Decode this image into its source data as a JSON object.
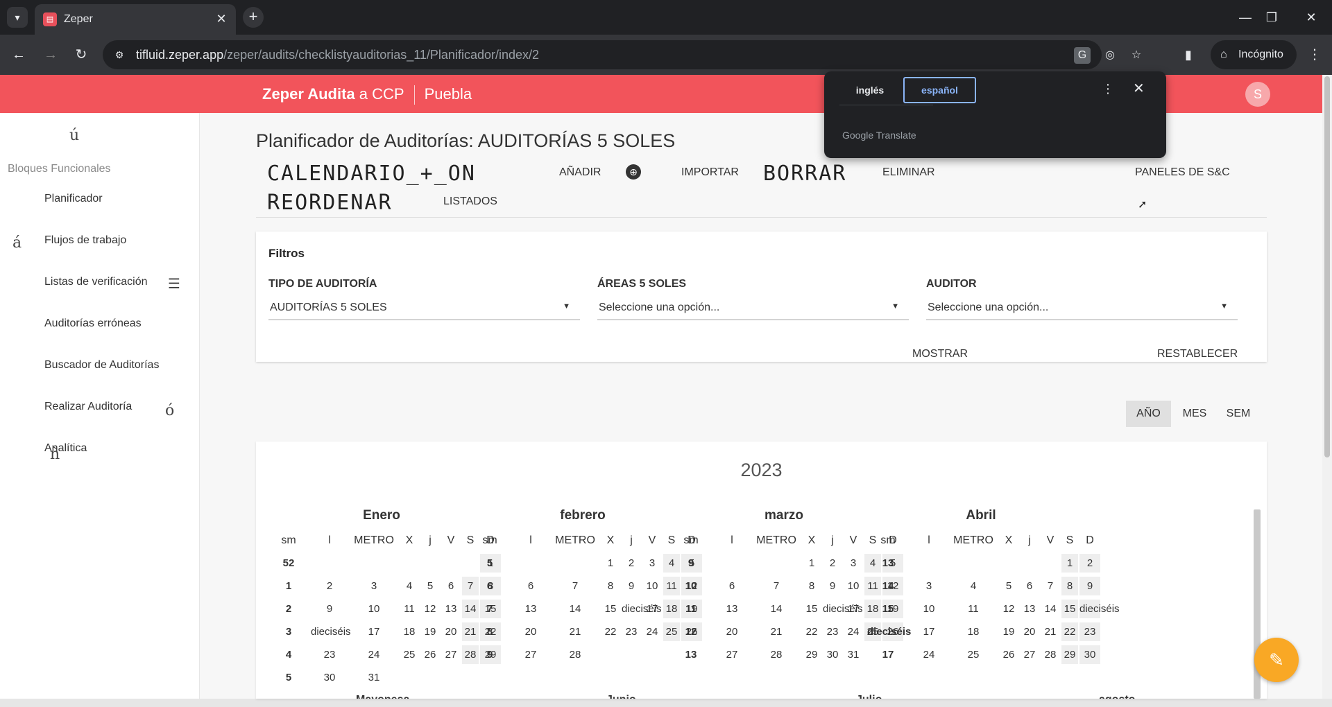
{
  "browser": {
    "tab_title": "Zeper",
    "url_host": "tifluid.zeper.app",
    "url_path": "/zeper/audits/checklistyauditorias_11/Planificador/index/2",
    "incognito_label": "Incógnito",
    "icons": [
      "chevron-down-icon",
      "favicon-icon",
      "close-icon",
      "plus-icon",
      "minimize-icon",
      "restore-icon",
      "close-window-icon",
      "back-icon",
      "forward-icon",
      "reload-icon",
      "site-info-icon",
      "translate-icon",
      "eye-off-icon",
      "star-icon",
      "side-panel-icon",
      "incognito-icon",
      "more-vert-icon"
    ]
  },
  "translate_popup": {
    "lang_source": "inglés",
    "lang_target": "español",
    "footer": "Google Translate"
  },
  "app": {
    "brand_strong": "Zeper Audita",
    "brand_rest": " a CCP",
    "location": "Puebla",
    "avatar_initial": "S"
  },
  "sidebar": {
    "marks": [
      "ú",
      "á",
      "ó",
      "ñ"
    ],
    "heading": "Bloques Funcionales",
    "items": [
      {
        "label": "Planificador"
      },
      {
        "label": "Flujos de trabajo"
      },
      {
        "label": "Listas de verificación"
      },
      {
        "label": "Auditorías erróneas"
      },
      {
        "label": "Buscador de Auditorías"
      },
      {
        "label": "Realizar Auditoría"
      },
      {
        "label": "Analítica"
      }
    ]
  },
  "page": {
    "title": "Planificador de Auditorías: AUDITORÍAS 5 SOLES",
    "actions": {
      "calendar_big": "CALENDARIO_+_ON",
      "add": "AÑADIR",
      "import": "IMPORTAR",
      "delete_big": "BORRAR",
      "delete": "ELIMINAR",
      "panels": "PANELES DE S&C",
      "reorder_big": "REORDENAR",
      "lists": "LISTADOS"
    }
  },
  "filters": {
    "title": "Filtros",
    "audit_type": {
      "label": "TIPO DE AUDITORÍA",
      "value": "AUDITORÍAS 5 SOLES"
    },
    "areas": {
      "label": "ÁREAS 5 SOLES",
      "value": "Seleccione una opción..."
    },
    "auditor": {
      "label": "AUDITOR",
      "value": "Seleccione una opción..."
    },
    "show_button": "MOSTRAR",
    "reset_button": "RESTABLECER"
  },
  "view": {
    "year": "AÑO",
    "month": "MES",
    "week": "SEM",
    "active": "year"
  },
  "calendar": {
    "year": "2023",
    "months": [
      {
        "name": "Enero",
        "headers": [
          "sm",
          "l",
          "METRO",
          "X",
          "j",
          "V",
          "S",
          "D"
        ],
        "rows": [
          [
            "52",
            "",
            "",
            "",
            "",
            "",
            "",
            "1"
          ],
          [
            "1",
            "2",
            "3",
            "4",
            "5",
            "6",
            "7",
            "8"
          ],
          [
            "2",
            "9",
            "10",
            "11",
            "12",
            "13",
            "14",
            "15"
          ],
          [
            "3",
            "dieciséis",
            "17",
            "18",
            "19",
            "20",
            "21",
            "22"
          ],
          [
            "4",
            "23",
            "24",
            "25",
            "26",
            "27",
            "28",
            "29"
          ],
          [
            "5",
            "30",
            "31",
            "",
            "",
            "",
            "",
            ""
          ]
        ]
      },
      {
        "name": "febrero",
        "headers": [
          "sm",
          "l",
          "METRO",
          "X",
          "j",
          "V",
          "S",
          "D"
        ],
        "rows": [
          [
            "5",
            "",
            "",
            "1",
            "2",
            "3",
            "4",
            "5"
          ],
          [
            "6",
            "6",
            "7",
            "8",
            "9",
            "10",
            "11",
            "12"
          ],
          [
            "7",
            "13",
            "14",
            "15",
            "dieciséis",
            "17",
            "18",
            "19"
          ],
          [
            "8",
            "20",
            "21",
            "22",
            "23",
            "24",
            "25",
            "26"
          ],
          [
            "9",
            "27",
            "28",
            "",
            "",
            "",
            "",
            ""
          ]
        ]
      },
      {
        "name": "marzo",
        "headers": [
          "sm",
          "l",
          "METRO",
          "X",
          "j",
          "V",
          "S",
          "D"
        ],
        "rows": [
          [
            "9",
            "",
            "",
            "1",
            "2",
            "3",
            "4",
            "5"
          ],
          [
            "10",
            "6",
            "7",
            "8",
            "9",
            "10",
            "11",
            "12"
          ],
          [
            "11",
            "13",
            "14",
            "15",
            "dieciséis",
            "17",
            "18",
            "19"
          ],
          [
            "12",
            "20",
            "21",
            "22",
            "23",
            "24",
            "25",
            "26"
          ],
          [
            "13",
            "27",
            "28",
            "29",
            "30",
            "31",
            "",
            ""
          ]
        ]
      },
      {
        "name": "Abril",
        "headers": [
          "sm",
          "l",
          "METRO",
          "X",
          "j",
          "V",
          "S",
          "D"
        ],
        "rows": [
          [
            "13",
            "",
            "",
            "",
            "",
            "",
            "1",
            "2"
          ],
          [
            "14",
            "3",
            "4",
            "5",
            "6",
            "7",
            "8",
            "9"
          ],
          [
            "15",
            "10",
            "11",
            "12",
            "13",
            "14",
            "15",
            "dieciséis"
          ],
          [
            "dieciséis",
            "17",
            "18",
            "19",
            "20",
            "21",
            "22",
            "23"
          ],
          [
            "17",
            "24",
            "25",
            "26",
            "27",
            "28",
            "29",
            "30"
          ]
        ]
      }
    ]
  }
}
